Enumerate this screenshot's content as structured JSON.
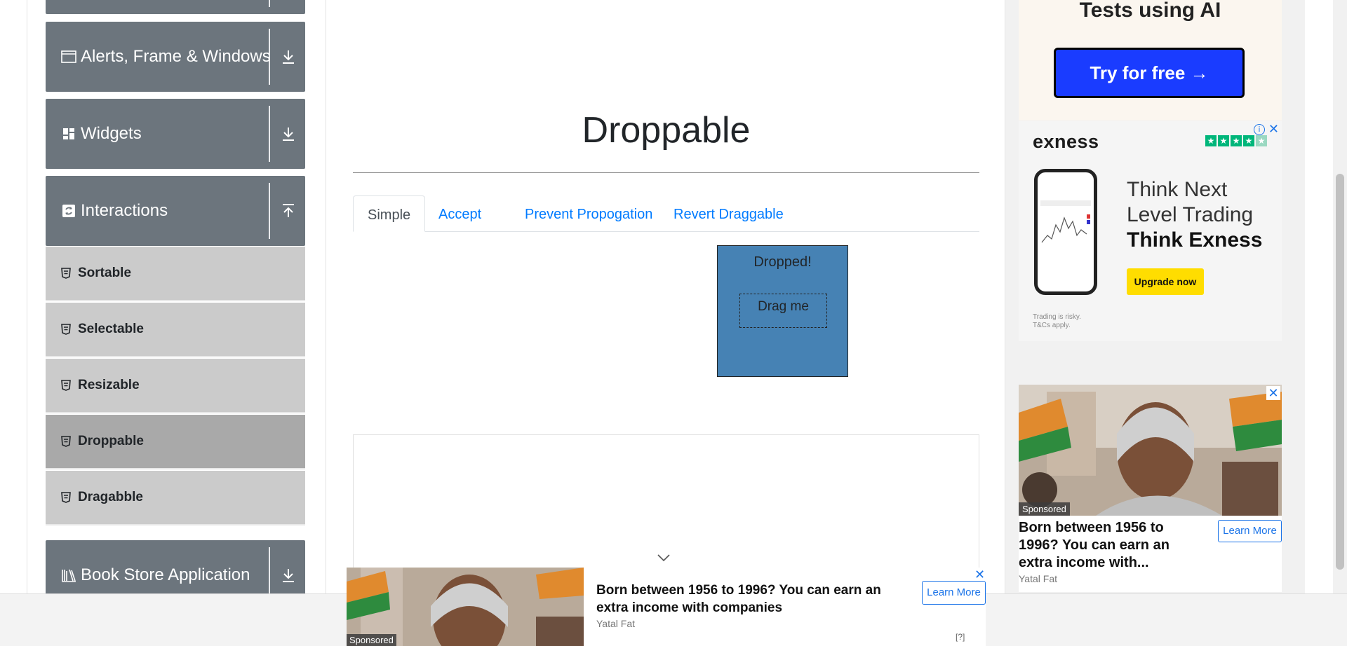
{
  "sidebar": {
    "groups": [
      {
        "label": "Alerts, Frame & Windows",
        "icon": "window-icon",
        "arrow": "download-arrow-icon"
      },
      {
        "label": "Widgets",
        "icon": "widgets-icon",
        "arrow": "download-arrow-icon"
      },
      {
        "label": "Interactions",
        "icon": "refresh-icon",
        "arrow": "upload-arrow-icon"
      },
      {
        "label": "Book Store Application",
        "icon": "books-icon",
        "arrow": "download-arrow-icon"
      }
    ],
    "items": [
      {
        "label": "Sortable"
      },
      {
        "label": "Selectable"
      },
      {
        "label": "Resizable"
      },
      {
        "label": "Droppable",
        "active": true
      },
      {
        "label": "Dragabble"
      }
    ]
  },
  "main": {
    "title": "Droppable",
    "tabs": [
      {
        "label": "Simple",
        "active": true
      },
      {
        "label": "Accept"
      },
      {
        "label": "Prevent Propogation"
      },
      {
        "label": "Revert Draggable"
      }
    ],
    "drop_label": "Dropped!",
    "drag_label": "Drag me"
  },
  "ads": {
    "top": {
      "heading": "Tests using AI",
      "button": "Try for free →"
    },
    "exness": {
      "logo": "exness",
      "line1": "Think Next",
      "line2": "Level Trading",
      "line3": "Think Exness",
      "button": "Upgrade now",
      "risk1": "Trading is risky.",
      "risk2": "T&Cs apply."
    },
    "sponsored_right": {
      "label": "Sponsored",
      "title": "Born between 1956 to 1996? You can earn an extra income with...",
      "button": "Learn More",
      "source": "Yatal Fat"
    },
    "sponsored_bottom": {
      "label": "Sponsored",
      "title": "Born between 1956 to 1996? You can earn an extra income with companies",
      "button": "Learn More",
      "source": "Yatal Fat",
      "help": "[?]"
    }
  },
  "colors": {
    "sidebar_group": "#6c757d",
    "menu_item": "#cbcbcb",
    "menu_active": "#a9a9a9",
    "drop_box": "#4682b4",
    "link": "#007bff"
  }
}
